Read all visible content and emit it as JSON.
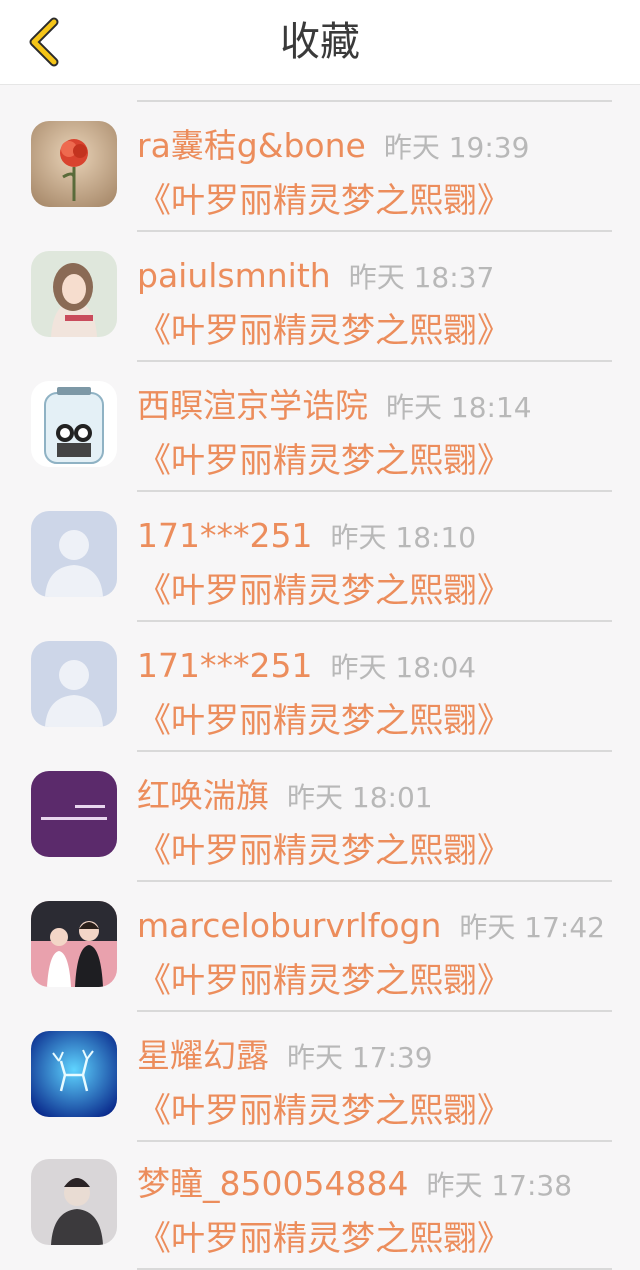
{
  "header": {
    "title": "收藏"
  },
  "book_title": "《叶罗丽精灵梦之熙翾》",
  "items": [
    {
      "name": "ra囊秸g&bone",
      "time": "昨天 19:39",
      "book": "《叶罗丽精灵梦之熙翾》",
      "avatar": "rose-avatar-image"
    },
    {
      "name": "paiulsmnith",
      "time": "昨天 18:37",
      "book": "《叶罗丽精灵梦之熙翾》",
      "avatar": "girl-avatar-image"
    },
    {
      "name": "西瞑渲京学诰院",
      "time": "昨天 18:14",
      "book": "《叶罗丽精灵梦之熙翾》",
      "avatar": "jar-avatar-image"
    },
    {
      "name": "171***251",
      "time": "昨天 18:10",
      "book": "《叶罗丽精灵梦之熙翾》",
      "avatar": "default-user-avatar"
    },
    {
      "name": "171***251",
      "time": "昨天 18:04",
      "book": "《叶罗丽精灵梦之熙翾》",
      "avatar": "default-user-avatar"
    },
    {
      "name": "红唤湍旗",
      "time": "昨天 18:01",
      "book": "《叶罗丽精灵梦之熙翾》",
      "avatar": "purple-text-avatar"
    },
    {
      "name": "marceloburvrlfogn",
      "time": "昨天 17:42",
      "book": "《叶罗丽精灵梦之熙翾》",
      "avatar": "couple-avatar-image"
    },
    {
      "name": "星耀幻露",
      "time": "昨天 17:39",
      "book": "《叶罗丽精灵梦之熙翾》",
      "avatar": "blue-deer-avatar"
    },
    {
      "name": "梦瞳_850054884",
      "time": "昨天 17:38",
      "book": "《叶罗丽精灵梦之熙翾》",
      "avatar": "photo-avatar-image"
    }
  ],
  "colors": {
    "accent_orange": "#ec8d5c",
    "time_gray": "#b8b8b8",
    "back_yellow": "#f5c518",
    "background": "#f7f6f7"
  }
}
